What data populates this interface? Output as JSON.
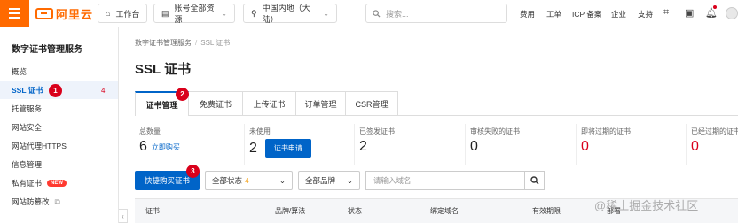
{
  "topbar": {
    "logo": "阿里云",
    "workbench": "工作台",
    "account": "账号全部资源",
    "region": "中国内地（大陆）",
    "search_placeholder": "搜索...",
    "nav": [
      "费用",
      "工单",
      "ICP 备案",
      "企业",
      "支持"
    ]
  },
  "sidebar": {
    "title": "数字证书管理服务",
    "items": [
      {
        "label": "概览"
      },
      {
        "label": "SSL 证书",
        "marker": "1",
        "count": "4"
      },
      {
        "label": "托管服务"
      },
      {
        "label": "网站安全"
      },
      {
        "label": "网站代理HTTPS"
      },
      {
        "label": "信息管理"
      },
      {
        "label": "私有证书",
        "tag": "NEW"
      },
      {
        "label": "网站防篡改"
      }
    ]
  },
  "breadcrumb": {
    "parent": "数字证书管理服务",
    "current": "SSL 证书"
  },
  "page_title": "SSL 证书",
  "tabs": {
    "items": [
      "证书管理",
      "免费证书",
      "上传证书",
      "订单管理",
      "CSR管理"
    ],
    "active": "证书管理",
    "marker": "2"
  },
  "stats": [
    {
      "label": "总数量",
      "value": "6",
      "link": "立即购买"
    },
    {
      "label": "未使用",
      "value": "2",
      "button": "证书申请"
    },
    {
      "label": "已签发证书",
      "value": "2"
    },
    {
      "label": "审核失败的证书",
      "value": "0"
    },
    {
      "label": "即将过期的证书",
      "value": "0",
      "alert": true
    },
    {
      "label": "已经过期的证书",
      "value": "0",
      "alert": true
    }
  ],
  "filters": {
    "buy_button": "快捷购买证书",
    "marker": "3",
    "status_select": "全部状态",
    "status_count": "4",
    "brand_select": "全部品牌",
    "domain_placeholder": "请输入域名"
  },
  "table": {
    "headers": [
      "证书",
      "品牌/算法",
      "状态",
      "绑定域名",
      "有效期限",
      "部署"
    ]
  },
  "watermark": "@稀土掘金技术社区",
  "colors": {
    "brand": "#ff6a00",
    "primary": "#0064c8",
    "alert": "#d9001b"
  }
}
